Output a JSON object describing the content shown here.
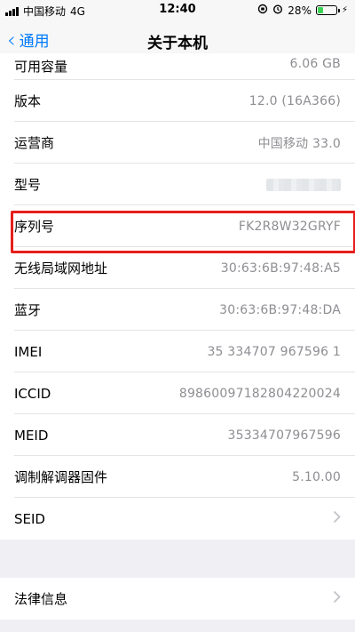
{
  "status_bar": {
    "carrier": "中国移动",
    "network": "4G",
    "time": "12:40",
    "battery_percent": "28%",
    "battery_level": 0.28
  },
  "nav": {
    "back_label": "通用",
    "title": "关于本机"
  },
  "rows": [
    {
      "label": "可用容量",
      "value": "6.06 GB"
    },
    {
      "label": "版本",
      "value": "12.0 (16A366)"
    },
    {
      "label": "运营商",
      "value": "中国移动 33.0"
    },
    {
      "label": "型号",
      "value": ""
    },
    {
      "label": "序列号",
      "value": "FK2R8W32GRYF"
    },
    {
      "label": "无线局域网地址",
      "value": "30:63:6B:97:48:A5"
    },
    {
      "label": "蓝牙",
      "value": "30:63:6B:97:48:DA"
    },
    {
      "label": "IMEI",
      "value": "35 334707 967596 1"
    },
    {
      "label": "ICCID",
      "value": "89860097182804220024"
    },
    {
      "label": "MEID",
      "value": "35334707967596"
    },
    {
      "label": "调制解调器固件",
      "value": "5.10.00"
    },
    {
      "label": "SEID",
      "value": ""
    }
  ],
  "legal": {
    "label": "法律信息"
  },
  "colors": {
    "accent": "#007aff",
    "highlight": "#e61e1e",
    "battery": "#3bd354"
  }
}
